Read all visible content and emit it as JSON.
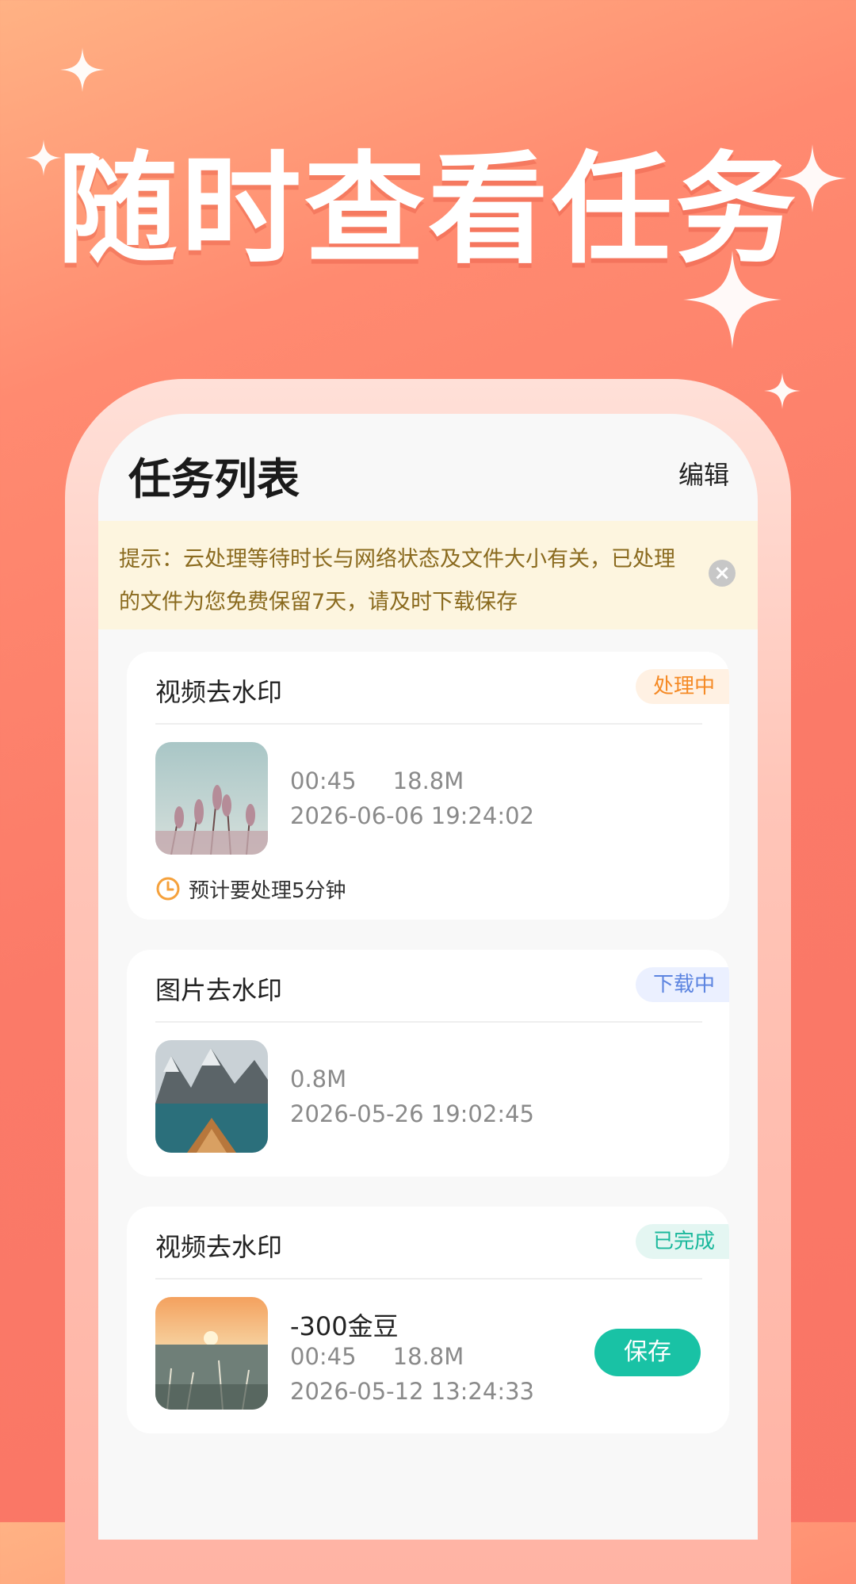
{
  "hero": {
    "title": "随时查看任务"
  },
  "page": {
    "title": "任务列表",
    "edit_label": "编辑"
  },
  "notice": {
    "text": "提示：云处理等待时长与网络状态及文件大小有关，已处理的文件为您免费保留7天，请及时下载保存",
    "close_icon": "close-icon"
  },
  "tasks": [
    {
      "title": "视频去水印",
      "status": "处理中",
      "meta": "00:45     18.8M",
      "datetime": "2026-06-06 19:24:02",
      "eta": "预计要处理5分钟",
      "thumb_icon": "reeds-photo"
    },
    {
      "title": "图片去水印",
      "status": "下载中",
      "meta": "0.8M",
      "datetime": "2026-05-26 19:02:45",
      "thumb_icon": "lake-boat-photo"
    },
    {
      "title": "视频去水印",
      "status": "已完成",
      "cost": "-300金豆",
      "meta": "00:45     18.8M",
      "datetime": "2026-05-12 13:24:33",
      "action": "保存",
      "thumb_icon": "sunset-field-photo"
    }
  ],
  "colors": {
    "processing": "#f58a25",
    "downloading": "#5c84e0",
    "done": "#1bb89c",
    "accent": "#19c2a5"
  }
}
